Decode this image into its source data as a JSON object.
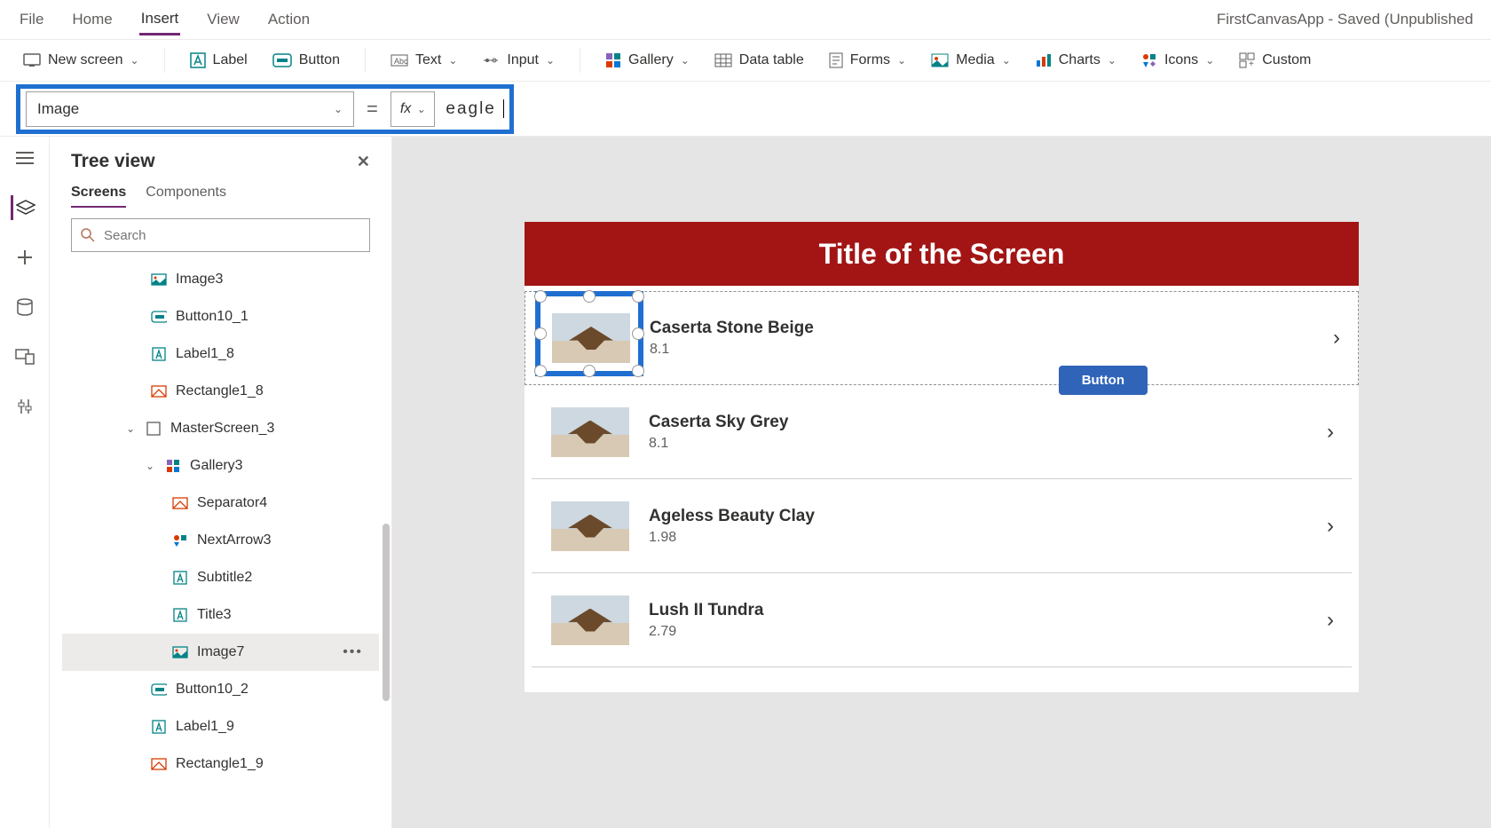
{
  "menubar": {
    "items": [
      "File",
      "Home",
      "Insert",
      "View",
      "Action"
    ],
    "active_index": 2,
    "app_title": "FirstCanvasApp - Saved (Unpublished"
  },
  "ribbon": {
    "new_screen": "New screen",
    "label": "Label",
    "button": "Button",
    "text": "Text",
    "input": "Input",
    "gallery": "Gallery",
    "data_table": "Data table",
    "forms": "Forms",
    "media": "Media",
    "charts": "Charts",
    "icons": "Icons",
    "custom": "Custom"
  },
  "formula": {
    "property": "Image",
    "value": "eagle"
  },
  "panel": {
    "title": "Tree view",
    "tabs": [
      "Screens",
      "Components"
    ],
    "active_tab": 0,
    "search_placeholder": "Search"
  },
  "tree": [
    {
      "icon": "image",
      "label": "Image3",
      "level": "l1"
    },
    {
      "icon": "button",
      "label": "Button10_1",
      "level": "l1"
    },
    {
      "icon": "label",
      "label": "Label1_8",
      "level": "l1"
    },
    {
      "icon": "rect",
      "label": "Rectangle1_8",
      "level": "l1"
    },
    {
      "icon": "screen",
      "label": "MasterScreen_3",
      "level": "l0",
      "expanded": true
    },
    {
      "icon": "gallery",
      "label": "Gallery3",
      "level": "lm",
      "expanded": true
    },
    {
      "icon": "rect",
      "label": "Separator4",
      "level": "lg"
    },
    {
      "icon": "iconctl",
      "label": "NextArrow3",
      "level": "lg"
    },
    {
      "icon": "label",
      "label": "Subtitle2",
      "level": "lg"
    },
    {
      "icon": "label",
      "label": "Title3",
      "level": "lg"
    },
    {
      "icon": "image",
      "label": "Image7",
      "level": "lg",
      "selected": true
    },
    {
      "icon": "button",
      "label": "Button10_2",
      "level": "l1"
    },
    {
      "icon": "label",
      "label": "Label1_9",
      "level": "l1"
    },
    {
      "icon": "rect",
      "label": "Rectangle1_9",
      "level": "l1"
    }
  ],
  "canvas": {
    "title": "Title of the Screen",
    "button_label": "Button",
    "rows": [
      {
        "title": "Caserta Stone Beige",
        "sub": "8.1"
      },
      {
        "title": "Caserta Sky Grey",
        "sub": "8.1"
      },
      {
        "title": "Ageless Beauty Clay",
        "sub": "1.98"
      },
      {
        "title": "Lush II Tundra",
        "sub": "2.79"
      }
    ]
  }
}
